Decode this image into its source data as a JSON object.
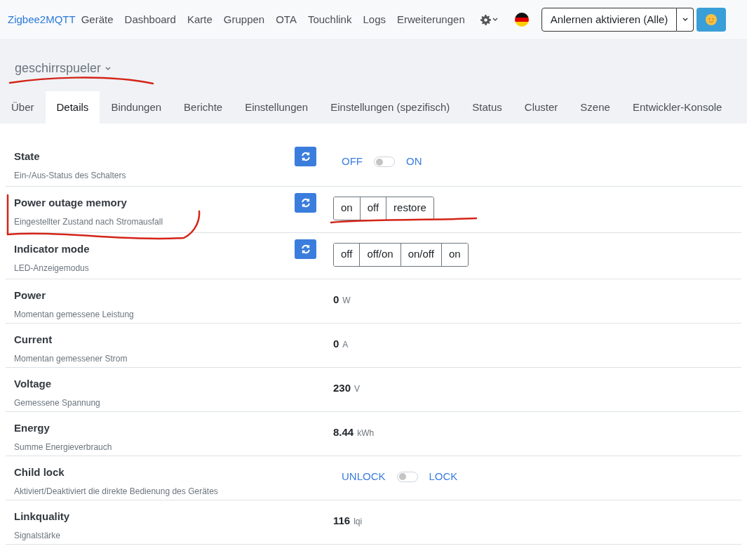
{
  "navbar": {
    "brand": "Zigbee2MQTT",
    "links": [
      "Geräte",
      "Dashboard",
      "Karte",
      "Gruppen",
      "OTA",
      "Touchlink",
      "Logs",
      "Erweiterungen"
    ],
    "permit_join_button": "Anlernen aktivieren (Alle)"
  },
  "device": {
    "name": "geschirrspueler"
  },
  "tabs": [
    {
      "label": "Über",
      "selected": false
    },
    {
      "label": "Details",
      "selected": true
    },
    {
      "label": "Bindungen",
      "selected": false
    },
    {
      "label": "Berichte",
      "selected": false
    },
    {
      "label": "Einstellungen",
      "selected": false
    },
    {
      "label": "Einstellungen (spezifisch)",
      "selected": false
    },
    {
      "label": "Status",
      "selected": false
    },
    {
      "label": "Cluster",
      "selected": false
    },
    {
      "label": "Szene",
      "selected": false
    },
    {
      "label": "Entwickler-Konsole",
      "selected": false
    }
  ],
  "features": [
    {
      "kind": "toggle",
      "name": "State",
      "description": "Ein-/Aus-Status des Schalters",
      "refresh": true,
      "off_label": "OFF",
      "on_label": "ON",
      "on": false
    },
    {
      "kind": "enum",
      "name": "Power outage memory",
      "description": "Eingestellter Zustand nach Stromausfall",
      "refresh": true,
      "options": [
        {
          "label": "on",
          "selected": false
        },
        {
          "label": "off",
          "selected": false
        },
        {
          "label": "restore",
          "selected": false
        }
      ]
    },
    {
      "kind": "enum",
      "name": "Indicator mode",
      "description": "LED-Anzeigemodus",
      "refresh": true,
      "options": [
        {
          "label": "off",
          "selected": false
        },
        {
          "label": "off/on",
          "selected": false
        },
        {
          "label": "on/off",
          "selected": false
        },
        {
          "label": "on",
          "selected": false
        }
      ]
    },
    {
      "kind": "numeric",
      "name": "Power",
      "description": "Momentan gemessene Leistung",
      "refresh": false,
      "value": "0",
      "unit": "W"
    },
    {
      "kind": "numeric",
      "name": "Current",
      "description": "Momentan gemessener Strom",
      "refresh": false,
      "value": "0",
      "unit": "A"
    },
    {
      "kind": "numeric",
      "name": "Voltage",
      "description": "Gemessene Spannung",
      "refresh": false,
      "value": "230",
      "unit": "V"
    },
    {
      "kind": "numeric",
      "name": "Energy",
      "description": "Summe Energieverbrauch",
      "refresh": false,
      "value": "8.44",
      "unit": "kWh"
    },
    {
      "kind": "toggle",
      "name": "Child lock",
      "description": "Aktiviert/Deaktiviert die direkte Bedienung des Gerätes",
      "refresh": false,
      "off_label": "UNLOCK",
      "on_label": "LOCK",
      "on": false
    },
    {
      "kind": "numeric",
      "name": "Linkquality",
      "description": "Signalstärke",
      "refresh": false,
      "value": "116",
      "unit": "lqi"
    }
  ]
}
